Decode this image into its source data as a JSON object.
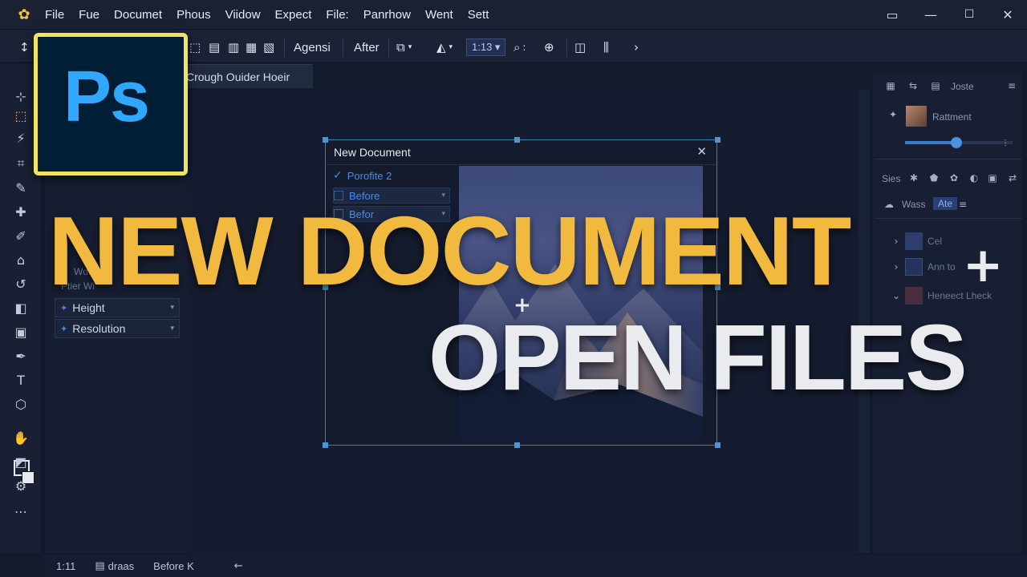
{
  "menubar": {
    "items": [
      "File",
      "Fue",
      "Documet",
      "Phous",
      "Viidow",
      "Expect",
      "File:",
      "Panrhow",
      "Went",
      "Sett"
    ]
  },
  "optionsbar": {
    "agensi_label": "Agensi",
    "after_label": "After",
    "zoom_value": "1:13",
    "zoom_options": [
      "1:13"
    ]
  },
  "document": {
    "tab_title": "Crough Ouider Hoeir"
  },
  "left_panel": {
    "faint_labels": [
      "Wdth",
      "Ptier Wi"
    ],
    "rows": [
      {
        "label": "Height"
      },
      {
        "label": "Resolution"
      }
    ]
  },
  "dialog": {
    "title": "New Document",
    "presets": [
      {
        "label": "Porofite 2",
        "checked": true
      },
      {
        "label": "Before",
        "checked": false
      },
      {
        "label": "Befor",
        "checked": false
      }
    ]
  },
  "right_panel": {
    "top_label": "Joste",
    "thumb_label": "Rattment",
    "slider_value": 0.48,
    "tabs_label": "Sies",
    "layers_label": "Wass",
    "layers_tab_active": "Ate",
    "layer_items": [
      "Cel",
      "Ann to",
      "Heneect Lheck"
    ]
  },
  "statusbar": {
    "items": [
      "1:11",
      "draas",
      "Before K"
    ]
  },
  "logo": {
    "text": "Ps"
  },
  "headline": {
    "line1": "NEW DOCUMENT",
    "line2": "OPEN FILES",
    "accent_color": "#f1b93e",
    "secondary_color": "#e9ebef"
  },
  "colors": {
    "app_bg": "#131a2c",
    "panel_bg": "#181f33",
    "selection_blue": "#3b7fb3",
    "logo_bg": "#001e36",
    "logo_border": "#f2e35f",
    "logo_text": "#31a8ff"
  }
}
